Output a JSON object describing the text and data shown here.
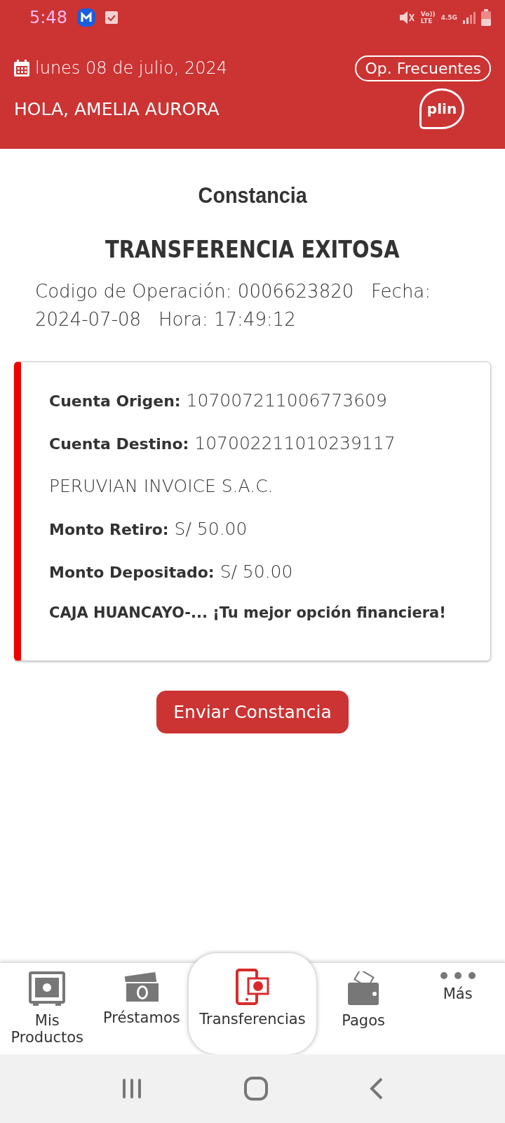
{
  "status_bar": {
    "time": "5:48",
    "volte": "Vo))",
    "lte": "LTE",
    "network": "4.5G"
  },
  "header": {
    "date": "lunes 08 de julio, 2024",
    "frequent_button": "Op. Frecuentes",
    "greeting": "HOLA, AMELIA AURORA",
    "plin_logo": "plin"
  },
  "title": "Constancia",
  "result": "TRANSFERENCIA EXITOSA",
  "operation_info": "Codigo de Operación: 0006623820   Fecha: 2024-07-08   Hora: 17:49:12",
  "details": [
    {
      "kind": "pair",
      "label": "Cuenta Origen:",
      "value": "107007211006773609"
    },
    {
      "kind": "pair",
      "label": "Cuenta Destino:",
      "value": "107002211010239117"
    },
    {
      "kind": "plain",
      "value": "PERUVIAN INVOICE S.A.C."
    },
    {
      "kind": "pair",
      "label": "Monto Retiro:",
      "value": "S/ 50.00"
    },
    {
      "kind": "pair",
      "label": "Monto Depositado:",
      "value": "S/ 50.00"
    },
    {
      "kind": "bold",
      "value": "CAJA HUANCAYO-... ¡Tu mejor opción financiera!"
    }
  ],
  "send_button": "Enviar Constancia",
  "bottom_nav": [
    {
      "kind": "safe",
      "label": "Mis Productos",
      "selected": false
    },
    {
      "kind": "cash",
      "label": "Préstamos",
      "selected": false
    },
    {
      "kind": "phone",
      "label": "Transferencias",
      "selected": true
    },
    {
      "kind": "wallet",
      "label": "Pagos",
      "selected": false
    },
    {
      "kind": "dots",
      "label": "Más",
      "selected": false
    }
  ]
}
